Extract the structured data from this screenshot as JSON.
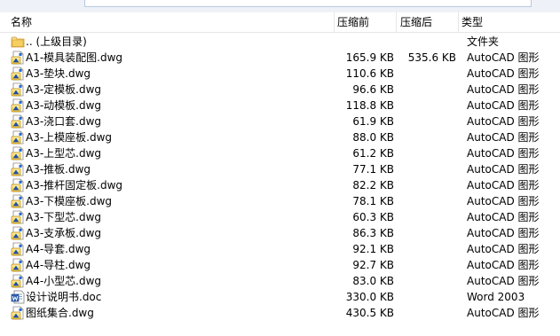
{
  "columns": {
    "name": "名称",
    "size": "压缩前",
    "packed": "压缩后",
    "type": "类型"
  },
  "rows": [
    {
      "icon": "folder-icon",
      "name": ".. (上级目录)",
      "size": "",
      "packed": "",
      "type": "文件夹"
    },
    {
      "icon": "autocad-file-icon",
      "name": "A1-模具装配图.dwg",
      "size": "165.9 KB",
      "packed": "535.6 KB",
      "type": "AutoCAD 图形"
    },
    {
      "icon": "autocad-file-icon",
      "name": "A3-垫块.dwg",
      "size": "110.6 KB",
      "packed": "",
      "type": "AutoCAD 图形"
    },
    {
      "icon": "autocad-file-icon",
      "name": "A3-定模板.dwg",
      "size": "96.6 KB",
      "packed": "",
      "type": "AutoCAD 图形"
    },
    {
      "icon": "autocad-file-icon",
      "name": "A3-动模板.dwg",
      "size": "118.8 KB",
      "packed": "",
      "type": "AutoCAD 图形"
    },
    {
      "icon": "autocad-file-icon",
      "name": "A3-浇口套.dwg",
      "size": "61.9 KB",
      "packed": "",
      "type": "AutoCAD 图形"
    },
    {
      "icon": "autocad-file-icon",
      "name": "A3-上模座板.dwg",
      "size": "88.0 KB",
      "packed": "",
      "type": "AutoCAD 图形"
    },
    {
      "icon": "autocad-file-icon",
      "name": "A3-上型芯.dwg",
      "size": "61.2 KB",
      "packed": "",
      "type": "AutoCAD 图形"
    },
    {
      "icon": "autocad-file-icon",
      "name": "A3-推板.dwg",
      "size": "77.1 KB",
      "packed": "",
      "type": "AutoCAD 图形"
    },
    {
      "icon": "autocad-file-icon",
      "name": "A3-推杆固定板.dwg",
      "size": "82.2 KB",
      "packed": "",
      "type": "AutoCAD 图形"
    },
    {
      "icon": "autocad-file-icon",
      "name": "A3-下模座板.dwg",
      "size": "78.1 KB",
      "packed": "",
      "type": "AutoCAD 图形"
    },
    {
      "icon": "autocad-file-icon",
      "name": "A3-下型芯.dwg",
      "size": "60.3 KB",
      "packed": "",
      "type": "AutoCAD 图形"
    },
    {
      "icon": "autocad-file-icon",
      "name": "A3-支承板.dwg",
      "size": "86.3 KB",
      "packed": "",
      "type": "AutoCAD 图形"
    },
    {
      "icon": "autocad-file-icon",
      "name": "A4-导套.dwg",
      "size": "92.1 KB",
      "packed": "",
      "type": "AutoCAD 图形"
    },
    {
      "icon": "autocad-file-icon",
      "name": "A4-导柱.dwg",
      "size": "92.7 KB",
      "packed": "",
      "type": "AutoCAD 图形"
    },
    {
      "icon": "autocad-file-icon",
      "name": "A4-小型芯.dwg",
      "size": "83.0 KB",
      "packed": "",
      "type": "AutoCAD 图形"
    },
    {
      "icon": "word-file-icon",
      "name": "设计说明书.doc",
      "size": "330.0 KB",
      "packed": "",
      "type": "Word 2003"
    },
    {
      "icon": "autocad-file-icon",
      "name": "图纸集合.dwg",
      "size": "430.5 KB",
      "packed": "",
      "type": "AutoCAD 图形"
    }
  ]
}
